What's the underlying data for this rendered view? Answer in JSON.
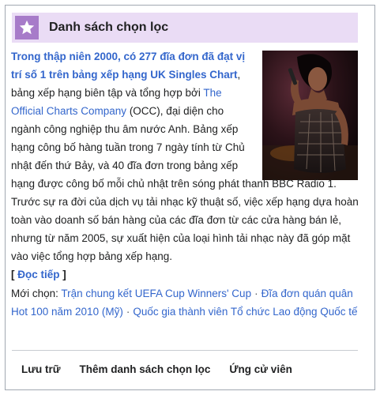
{
  "header": {
    "title": "Danh sách chọn lọc",
    "icon": "star-icon",
    "accent_color": "#a77bc9",
    "band_color": "#eadcf5"
  },
  "featured": {
    "image": "performer-on-stage-photo",
    "lead_link": "Trong thập niên 2000, có 277 đĩa đơn đã đạt vị trí số 1 trên bảng xếp hạng UK Singles Chart",
    "text_1": ", bảng xếp hạng biên tập và tổng hợp bởi ",
    "occ_link": "The Official Charts Company",
    "text_2": " (OCC), đại diện cho ngành công nghiệp thu âm nước Anh. Bảng xếp hạng công bố hàng tuần trong 7 ngày tính từ Chủ nhật đến thứ Bảy, và 40 đĩa đơn trong bảng xếp hạng được công bố mỗi chủ nhật trên sóng phát thanh BBC Radio 1. Trước sự ra đời của dịch vụ tải nhạc kỹ thuật số, việc xếp hạng dựa hoàn toàn vào doanh số bán hàng của các đĩa đơn từ các cửa hàng bán lẻ, nhưng từ năm 2005, sự xuất hiện của loại hình tải nhạc này đã góp mặt vào việc tổng hợp bảng xếp hạng.",
    "more_open": "[",
    "more_link": "Đọc tiếp",
    "more_close": "]"
  },
  "recent": {
    "label": "Mới chọn:",
    "items": [
      "Trận chung kết UEFA Cup Winners' Cup",
      "Đĩa đơn quán quân Hot 100 năm 2010 (Mỹ)",
      "Quốc gia thành viên Tổ chức Lao động Quốc tế"
    ],
    "separator": "·"
  },
  "footer": {
    "archive": "Lưu trữ",
    "add_list": "Thêm danh sách chọn lọc",
    "candidates": "Ứng cử viên"
  },
  "colors": {
    "link": "#3366cc",
    "text": "#202122",
    "border": "#a2a9b1"
  }
}
